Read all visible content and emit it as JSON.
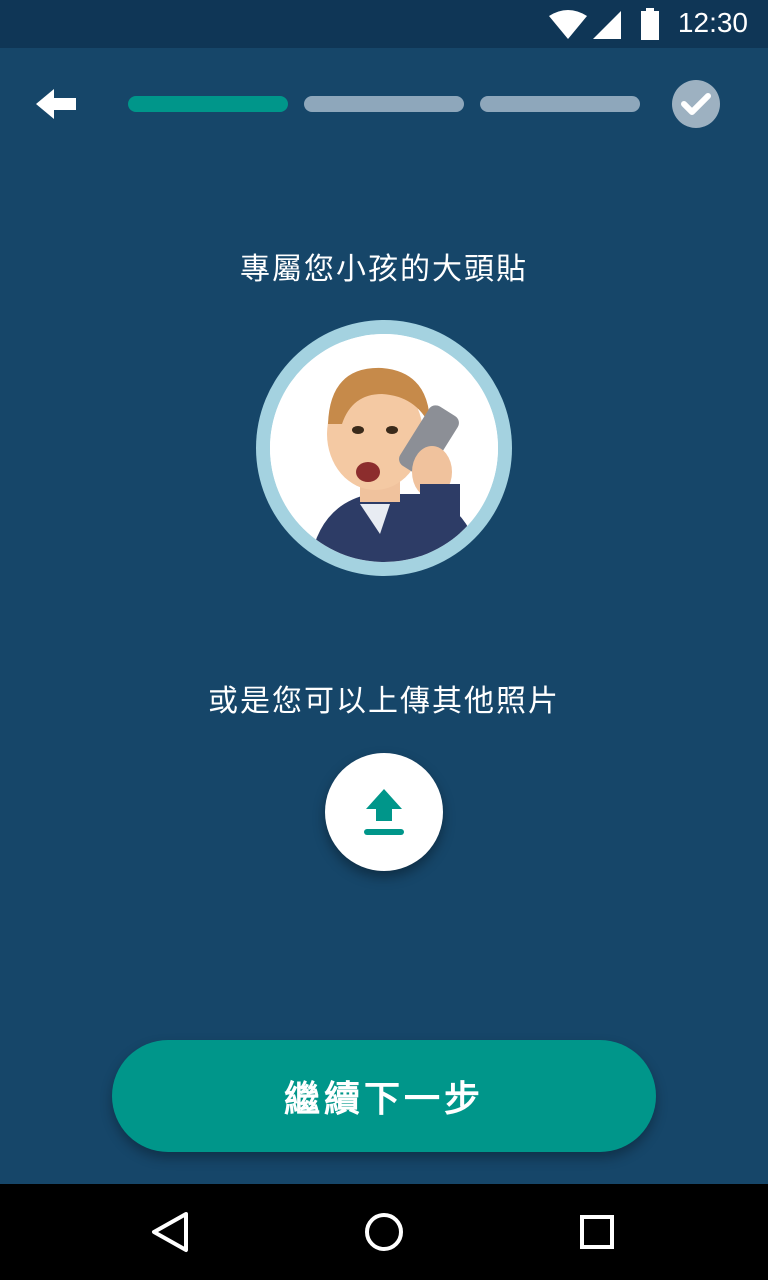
{
  "status_bar": {
    "time": "12:30",
    "icons": [
      "wifi-icon",
      "signal-icon",
      "battery-icon"
    ]
  },
  "top_bar": {
    "back_icon": "arrow-left-icon",
    "progress": {
      "total_steps": 3,
      "current_step": 1
    },
    "finish_icon": "check-icon"
  },
  "main": {
    "title": "專屬您小孩的大頭貼",
    "avatar_icon": "child-photo",
    "upload_prompt": "或是您可以上傳其他照片",
    "upload_icon": "upload-icon"
  },
  "footer": {
    "next_label": "繼續下一步"
  },
  "nav_bar": {
    "icons": [
      "back-triangle-icon",
      "home-circle-icon",
      "recents-square-icon"
    ]
  },
  "colors": {
    "background": "#164669",
    "status_bar": "#0f3656",
    "accent": "#00968a",
    "progress_inactive": "#8ea7bb",
    "avatar_ring": "#a4d2e0"
  }
}
